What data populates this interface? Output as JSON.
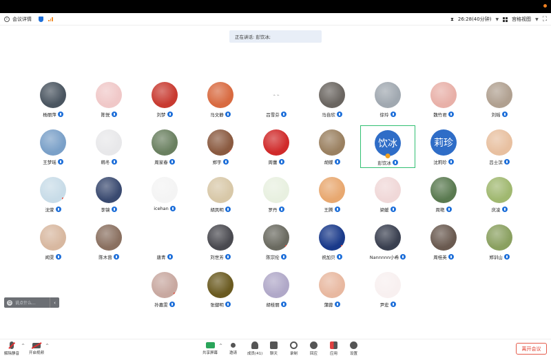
{
  "topbar": {
    "meeting_details": "会议详情",
    "timer": "26:28(40分钟)",
    "view_mode": "宫格视图"
  },
  "speaker_banner": "正在讲话: 彭饮冰;",
  "participants": [
    {
      "name": "杨丽萍",
      "avatar": "photo",
      "color": "#4a5560"
    },
    {
      "name": "陈悦",
      "avatar": "photo",
      "color": "#f0c8c8"
    },
    {
      "name": "刘梦",
      "avatar": "photo",
      "color": "#c83a30"
    },
    {
      "name": "马文静",
      "avatar": "photo",
      "color": "#d86a40"
    },
    {
      "name": "吕雪芬",
      "avatar": "blank",
      "color": "#ffffff",
      "placeholder": "⌁ ⌁"
    },
    {
      "name": "马自欣",
      "avatar": "photo",
      "color": "#6a6560"
    },
    {
      "name": "徐玲",
      "avatar": "photo",
      "color": "#a0a8b0"
    },
    {
      "name": "魏竹君",
      "avatar": "photo",
      "color": "#e8b0a8"
    },
    {
      "name": "刘瑶",
      "avatar": "photo",
      "color": "#b0a090"
    },
    {
      "name": "王梦瑶",
      "avatar": "photo",
      "color": "#7aa0c8"
    },
    {
      "name": "韩冬",
      "avatar": "photo",
      "color": "#e8e8ea"
    },
    {
      "name": "周家春",
      "avatar": "photo",
      "color": "#6a8060"
    },
    {
      "name": "郑宇",
      "avatar": "photo",
      "color": "#8a5a40",
      "flag": true
    },
    {
      "name": "周蕾",
      "avatar": "photo",
      "color": "#d02a2a"
    },
    {
      "name": "胡蝶",
      "avatar": "photo",
      "color": "#9a8060"
    },
    {
      "name": "彭饮冰",
      "avatar": "text",
      "text": "饮冰",
      "color": "#2f6dc7",
      "active": true,
      "star": true
    },
    {
      "name": "沈莉珍",
      "avatar": "text",
      "text": "莉珍",
      "color": "#2f6dc7"
    },
    {
      "name": "吕士滨",
      "avatar": "photo",
      "color": "#e8c0a0"
    },
    {
      "name": "沈萱",
      "avatar": "photo",
      "color": "#c8dce8",
      "flag": true
    },
    {
      "name": "李镜",
      "avatar": "photo",
      "color": "#3a4a70"
    },
    {
      "name": "icehan",
      "avatar": "photo",
      "color": "#f4f4f4"
    },
    {
      "name": "胡凤明",
      "avatar": "photo",
      "color": "#d8c8a8"
    },
    {
      "name": "罗丹",
      "avatar": "photo",
      "color": "#e8f0e0"
    },
    {
      "name": "王腾",
      "avatar": "photo",
      "color": "#e8a870"
    },
    {
      "name": "梁媛",
      "avatar": "photo",
      "color": "#f0d8d8"
    },
    {
      "name": "周艳",
      "avatar": "photo",
      "color": "#5a7a50"
    },
    {
      "name": "庆凌",
      "avatar": "photo",
      "color": "#a0b870"
    },
    {
      "name": "闻雯",
      "avatar": "photo",
      "color": "#d8b8a0"
    },
    {
      "name": "陈木茵",
      "avatar": "photo",
      "color": "#8a7060"
    },
    {
      "name": "唐青",
      "avatar": "photo",
      "color": "#ffffff"
    },
    {
      "name": "刘世芳",
      "avatar": "photo",
      "color": "#4a4a50"
    },
    {
      "name": "陈宗伦",
      "avatar": "photo",
      "color": "#6a6a60",
      "flag": true
    },
    {
      "name": "祝加贝",
      "avatar": "photo",
      "color": "#1a3a8a",
      "flag": true
    },
    {
      "name": "Nannnnn小希",
      "avatar": "photo",
      "color": "#3a4050"
    },
    {
      "name": "周桂英",
      "avatar": "photo",
      "color": "#6a5a50"
    },
    {
      "name": "郑训山",
      "avatar": "photo",
      "color": "#8aa060"
    },
    {
      "name": "孙嘉雯",
      "avatar": "photo",
      "color": "#c8a8a0",
      "flag": true
    },
    {
      "name": "张健明",
      "avatar": "photo",
      "color": "#6a5a20"
    },
    {
      "name": "胡桂丽",
      "avatar": "photo",
      "color": "#b0a8c8"
    },
    {
      "name": "蒲蓉",
      "avatar": "photo",
      "color": "#e8b8a0"
    },
    {
      "name": "尹宏",
      "avatar": "photo",
      "color": "#f8f0f0"
    }
  ],
  "chat_input": {
    "placeholder": "说点什么..."
  },
  "toolbar": {
    "mute": "解除静音",
    "video": "开启视频",
    "share": "共享屏幕",
    "invite": "邀请",
    "members": "成员(41)",
    "chat": "聊天",
    "record": "录制",
    "reactions": "回应",
    "apps": "应用",
    "settings": "设置",
    "leave": "离开会议"
  }
}
